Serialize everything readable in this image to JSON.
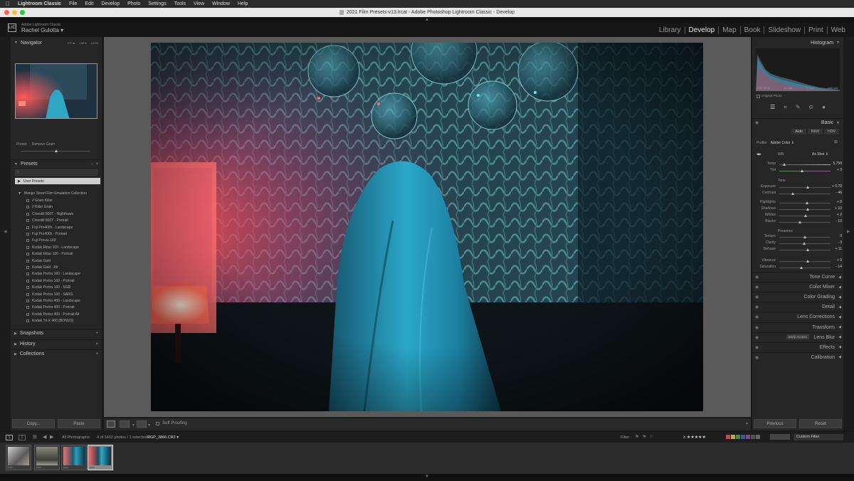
{
  "menubar": {
    "apple": "",
    "items": [
      "Lightroom Classic",
      "File",
      "Edit",
      "Develop",
      "Photo",
      "Settings",
      "Tools",
      "View",
      "Window",
      "Help"
    ]
  },
  "window": {
    "title": "2021 Film Presets-v13.lrcat - Adobe Photoshop Lightroom Classic - Develop"
  },
  "identity": {
    "logo": "LrC",
    "product": "Adobe Lightroom Classic",
    "user": "Rachel Gulotta ▾"
  },
  "modules": [
    "Library",
    "Develop",
    "Map",
    "Book",
    "Slideshow",
    "Print",
    "Web"
  ],
  "active_module": "Develop",
  "navigator": {
    "title": "Navigator",
    "zoom_options": [
      "FIT ≑",
      "100%",
      "121%"
    ]
  },
  "preset_amount": {
    "label": "Preset",
    "value": "Remove Grain"
  },
  "presets": {
    "title": "Presets",
    "user_presets": "User Presets",
    "collection": "Mango Street Film Emulation Collection",
    "items": [
      "// Grain Killer",
      "// Killer Grain",
      "Cinestill 800T - Nighthawk",
      "Cinestill 800T - Portrait",
      "Fuji Pro400h - Landscape",
      "Fuji Pro400h - Portrait",
      "Fuji Provia 100",
      "Kodak Ektar 100 - Landscape",
      "Kodak Ektar 100 - Portrait",
      "Kodak Gold",
      "Kodak Gold - Alt",
      "Kodak Portra 160 - Landscape",
      "Kodak Portra 160 - Portrait",
      "Kodak Portra 160 - SGR",
      "Kodak Portra 160 - SARG",
      "Kodak Portra 400 - Landscape",
      "Kodak Portra 400 - Portrait",
      "Kodak Portra 400 - Portrait Alt",
      "Kodak Tri-X 400 (BONUS)"
    ]
  },
  "left_sections": [
    "Snapshots",
    "History",
    "Collections"
  ],
  "left_buttons": {
    "copy": "Copy...",
    "paste": "Paste"
  },
  "histogram": {
    "title": "Histogram",
    "info": [
      "ISO 1600",
      "24 mm",
      "f / 1.4",
      "1/60 sec"
    ],
    "original_photo": "Original Photo"
  },
  "basic": {
    "title": "Basic",
    "modes": [
      "Auto",
      "B&W",
      "HDR"
    ],
    "profile_label": "Profile:",
    "profile_value": "Adobe Color ⇕",
    "wb_label": "WB:",
    "wb_value": "As Shot ⇕",
    "sliders": [
      {
        "group": "wb",
        "label": "Temp",
        "value": "5,750",
        "pos": 0.1
      },
      {
        "group": "wb",
        "label": "Tint",
        "value": "+ 3",
        "pos": 0.45
      },
      {
        "group": "tone",
        "label": "Exposure",
        "value": "+ 0.70",
        "pos": 0.55
      },
      {
        "group": "tone",
        "label": "Contrast",
        "value": "- 46",
        "pos": 0.27
      },
      {
        "group": "tone",
        "label": "Highlights",
        "value": "+ 8",
        "pos": 0.54
      },
      {
        "group": "tone",
        "label": "Shadows",
        "value": "+ 10",
        "pos": 0.55
      },
      {
        "group": "tone",
        "label": "Whites",
        "value": "+ 2",
        "pos": 0.51
      },
      {
        "group": "tone",
        "label": "Blacks",
        "value": "- 19",
        "pos": 0.4
      },
      {
        "group": "presence",
        "label": "Texture",
        "value": "0",
        "pos": 0.5
      },
      {
        "group": "presence",
        "label": "Clarity",
        "value": "- 3",
        "pos": 0.48
      },
      {
        "group": "presence",
        "label": "Dehaze",
        "value": "+ 11",
        "pos": 0.56
      },
      {
        "group": "presence",
        "label": "Vibrance",
        "value": "+ 9",
        "pos": 0.55
      },
      {
        "group": "presence",
        "label": "Saturation",
        "value": "- 14",
        "pos": 0.43
      }
    ],
    "tone_label": "Tone",
    "presence_label": "Presence"
  },
  "panels": [
    "Tone Curve",
    "Color Mixer",
    "Color Grading",
    "Detail",
    "Lens Corrections",
    "Transform",
    "Lens Blur",
    "Effects",
    "Calibration"
  ],
  "lens_blur_badge": "Early Access",
  "right_buttons": {
    "previous": "Previous",
    "reset": "Reset"
  },
  "toolbar": {
    "soft_proofing": "Soft Proofing"
  },
  "filmbar": {
    "source": "All Photographs",
    "count": "4 of 1412 photos / 1 selected /",
    "filename": "RGP_3866.CR2 ▾",
    "filter_label": "Filter :",
    "rating": "≥ ★★★★★",
    "custom_filter": "Custom Filter"
  },
  "colors": {
    "accent": "#cfcfcf",
    "panel": "#262626",
    "center": "#5a5a5a"
  }
}
